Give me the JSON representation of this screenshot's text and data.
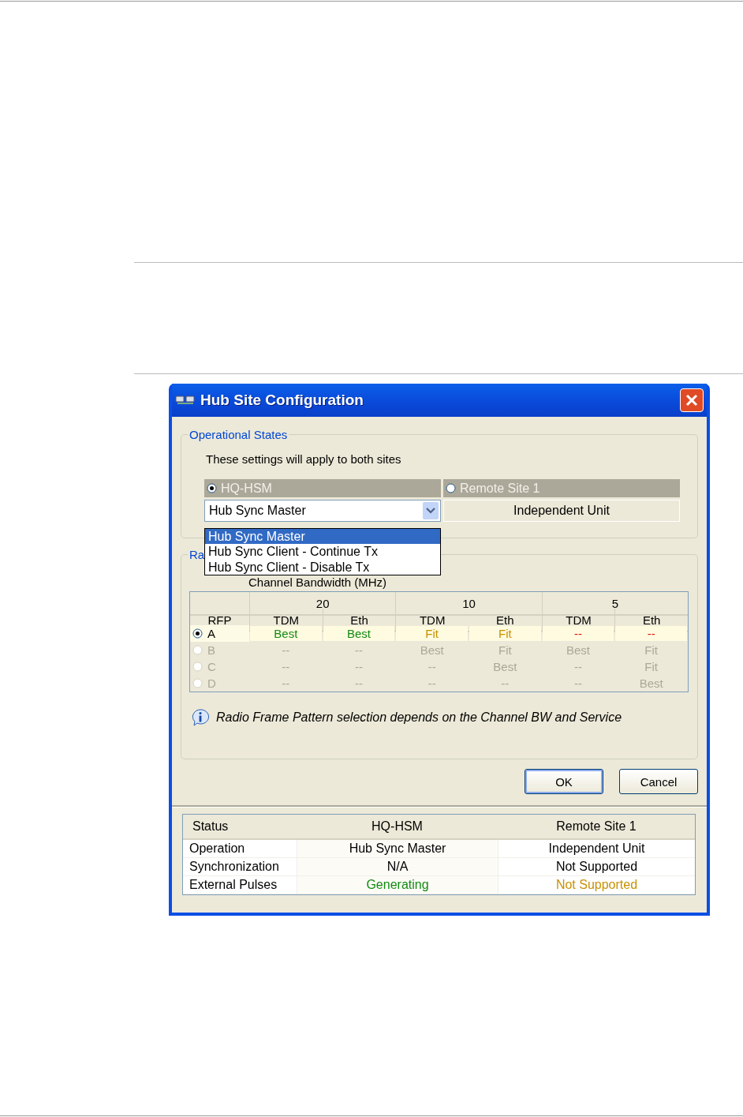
{
  "dialog": {
    "title": "Hub Site Configuration"
  },
  "operational_states": {
    "legend": "Operational States",
    "note": "These settings will apply to both sites",
    "sites": [
      {
        "label": "HQ-HSM",
        "selected": true
      },
      {
        "label": "Remote Site 1",
        "selected": false
      }
    ],
    "combo": {
      "value": "Hub Sync Master",
      "expanded": true,
      "options": [
        {
          "label": "Hub Sync Master",
          "selected": true
        },
        {
          "label": "Hub Sync Client - Continue Tx",
          "selected": false
        },
        {
          "label": "Hub Sync Client - Disable Tx",
          "selected": false
        }
      ]
    },
    "remote_value": "Independent Unit"
  },
  "rfp_group": {
    "legend": "Ra",
    "bandwidth_label": "Channel Bandwidth (MHz)",
    "bandwidths": [
      "20",
      "10",
      "5"
    ],
    "row_header_column": "RFP",
    "columns": [
      "TDM",
      "Eth",
      "TDM",
      "Eth",
      "TDM",
      "Eth"
    ],
    "rows": [
      {
        "label": "A",
        "selected": true,
        "disabled": false,
        "cells": [
          {
            "text": "Best",
            "kind": "best"
          },
          {
            "text": "Best",
            "kind": "best"
          },
          {
            "text": "Fit",
            "kind": "fit"
          },
          {
            "text": "Fit",
            "kind": "fit"
          },
          {
            "text": "--",
            "kind": "none"
          },
          {
            "text": "--",
            "kind": "none"
          }
        ]
      },
      {
        "label": "B",
        "selected": false,
        "disabled": true,
        "cells": [
          {
            "text": "--",
            "kind": "none"
          },
          {
            "text": "--",
            "kind": "none"
          },
          {
            "text": "Best",
            "kind": "best"
          },
          {
            "text": "Fit",
            "kind": "fit"
          },
          {
            "text": "Best",
            "kind": "best"
          },
          {
            "text": "Fit",
            "kind": "fit"
          }
        ]
      },
      {
        "label": "C",
        "selected": false,
        "disabled": true,
        "cells": [
          {
            "text": "--",
            "kind": "none"
          },
          {
            "text": "--",
            "kind": "none"
          },
          {
            "text": "--",
            "kind": "none"
          },
          {
            "text": "Best",
            "kind": "best"
          },
          {
            "text": "--",
            "kind": "none"
          },
          {
            "text": "Fit",
            "kind": "fit"
          }
        ]
      },
      {
        "label": "D",
        "selected": false,
        "disabled": true,
        "cells": [
          {
            "text": "--",
            "kind": "none"
          },
          {
            "text": "--",
            "kind": "none"
          },
          {
            "text": "--",
            "kind": "none"
          },
          {
            "text": "--",
            "kind": "none"
          },
          {
            "text": "--",
            "kind": "none"
          },
          {
            "text": "Best",
            "kind": "best"
          }
        ]
      }
    ],
    "info": "Radio Frame Pattern selection depends on the Channel BW and Service"
  },
  "buttons": [
    {
      "label": "OK",
      "default": true
    },
    {
      "label": "Cancel",
      "default": false
    }
  ],
  "status_table": {
    "row_header_column": "Status",
    "columns": [
      "HQ-HSM",
      "Remote Site 1"
    ],
    "rows": [
      {
        "label": "Operation",
        "cells": [
          {
            "text": "Hub Sync Master",
            "kind": "plain"
          },
          {
            "text": "Independent Unit",
            "kind": "plain"
          }
        ]
      },
      {
        "label": "Synchronization",
        "cells": [
          {
            "text": "N/A",
            "kind": "plain"
          },
          {
            "text": "Not Supported",
            "kind": "plain"
          }
        ]
      },
      {
        "label": "External Pulses",
        "cells": [
          {
            "text": "Generating",
            "kind": "ok"
          },
          {
            "text": "Not Supported",
            "kind": "warn"
          }
        ]
      }
    ]
  }
}
